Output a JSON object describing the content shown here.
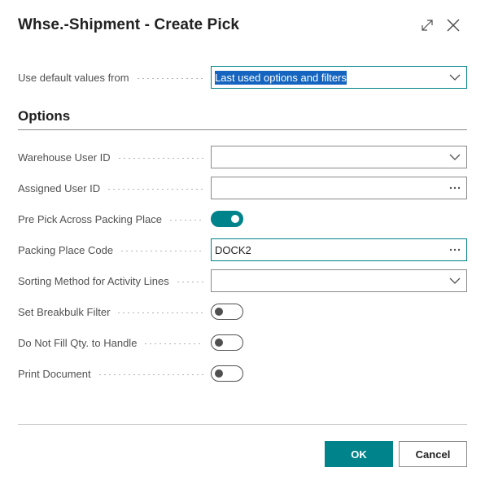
{
  "dialog": {
    "title": "Whse.-Shipment - Create Pick",
    "expand_icon": "expand-icon",
    "close_icon": "close-icon"
  },
  "defaults": {
    "label": "Use default values from",
    "value": "Last used options and filters"
  },
  "options": {
    "section_title": "Options",
    "warehouse_user_id": {
      "label": "Warehouse User ID",
      "value": ""
    },
    "assigned_user_id": {
      "label": "Assigned User ID",
      "value": ""
    },
    "pre_pick_across_packing_place": {
      "label": "Pre Pick Across Packing Place",
      "checked": true
    },
    "packing_place_code": {
      "label": "Packing Place Code",
      "value": "DOCK2"
    },
    "sorting_method": {
      "label": "Sorting Method for Activity Lines",
      "value": ""
    },
    "set_breakbulk_filter": {
      "label": "Set Breakbulk Filter",
      "checked": false
    },
    "do_not_fill_qty": {
      "label": "Do Not Fill Qty. to Handle",
      "checked": false
    },
    "print_document": {
      "label": "Print Document",
      "checked": false
    }
  },
  "footer": {
    "ok_label": "OK",
    "cancel_label": "Cancel"
  },
  "colors": {
    "accent": "#00838a",
    "selection": "#1565c0"
  }
}
